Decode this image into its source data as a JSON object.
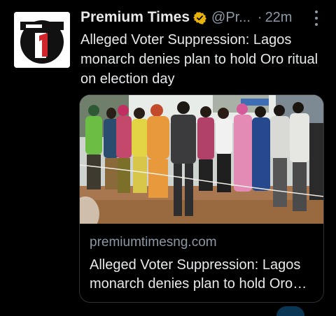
{
  "tweet": {
    "author_name": "Premium Times",
    "handle": "@Pr...",
    "separator": "·",
    "time": "22m",
    "text": "Alleged Voter Suppression: Lagos monarch denies plan to hold Oro ritual on election day",
    "verified": true
  },
  "card": {
    "domain": "premiumtimesng.com",
    "title": "Alleged Voter Suppression: Lagos monarch denies plan to hold Oro ritual on election day"
  },
  "colors": {
    "background": "#000000",
    "text": "#e7e9ea",
    "secondary": "#8b98a5",
    "verified_badge": "#e8b10b",
    "logo_red": "#d0262b",
    "border": "#2f3336"
  },
  "icons": {
    "avatar": "premium-times-logo",
    "verified": "verified-badge-icon",
    "more": "more-vertical-icon"
  }
}
